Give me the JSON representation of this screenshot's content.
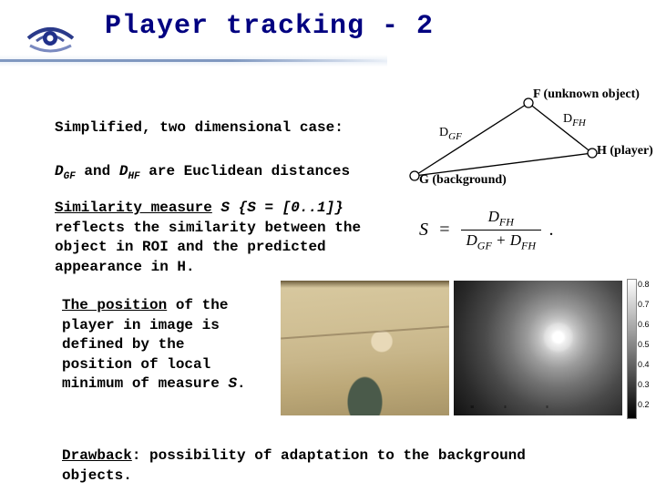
{
  "title": "Player tracking - 2",
  "paragraphs": {
    "p1": "Simplified, two dimensional case:",
    "p2_a": "D",
    "p2_gf": "GF",
    "p2_b": " and ",
    "p2_hf": "HF",
    "p2_c": " are Euclidean distances",
    "p3_a": "Similarity measure",
    "p3_b": " S {S = [0..1]}",
    "p3_c": " reflects the similarity between the object in ROI and the predicted appearance in H.",
    "p4_a": "The position",
    "p4_b": " of the player in image is defined by the position of local minimum of measure ",
    "p4_c": "S",
    "p4_d": ".",
    "p5_a": "Drawback",
    "p5_b": ": possibility of adaptation to the background objects."
  },
  "triangle": {
    "F": "F (unknown object)",
    "H": "H (player)",
    "G": "G (background)",
    "DGF": "D",
    "DGF_sub": "GF",
    "DFH": "D",
    "DFH_sub": "FH"
  },
  "formula": {
    "S": "S",
    "eq": "=",
    "num_D": "D",
    "num_sub": "FH",
    "den_D1": "D",
    "den_sub1": "GF",
    "den_plus": " + ",
    "den_D2": "D",
    "den_sub2": "FH",
    "dot": "."
  },
  "colorbar": {
    "ticks": [
      "0.8",
      "0.7",
      "0.6",
      "0.5",
      "0.4",
      "0.3",
      "0.2"
    ]
  }
}
